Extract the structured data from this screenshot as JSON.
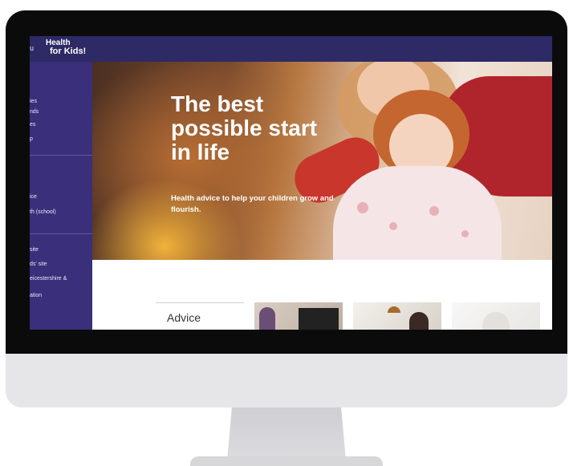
{
  "header": {
    "menu_label_fragment": "u",
    "logo_line1": "Health",
    "logo_line2": "for Kids!"
  },
  "sidebar": {
    "group1": [
      "ies",
      "nds",
      "es",
      "p"
    ],
    "group2": [
      "ice",
      "th (school)"
    ],
    "group3": [
      "site",
      "ds' site",
      "eicestershire &",
      "ation"
    ]
  },
  "hero": {
    "title_line1": "The best",
    "title_line2": "possible start",
    "title_line3": "in life",
    "subtitle": "Health advice to help your children grow and flourish."
  },
  "main": {
    "advice_label": "Advice"
  },
  "colors": {
    "topbar": "#2e2a66",
    "sidebar": "#3a2f7a",
    "bezel": "#0b0b0b",
    "chin": "#e6e6e8"
  }
}
